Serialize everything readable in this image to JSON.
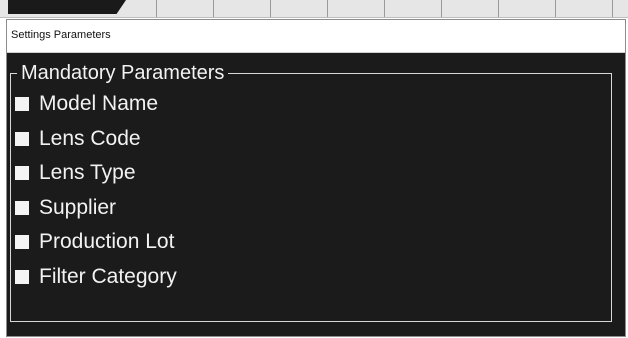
{
  "window": {
    "title": "Settings Parameters"
  },
  "group": {
    "legend": "Mandatory Parameters"
  },
  "parameters": [
    {
      "label": "Model Name",
      "checked": false
    },
    {
      "label": "Lens Code",
      "checked": false
    },
    {
      "label": "Lens Type",
      "checked": false
    },
    {
      "label": "Supplier",
      "checked": false
    },
    {
      "label": "Production Lot",
      "checked": false
    },
    {
      "label": "Filter Category",
      "checked": false
    }
  ],
  "colors": {
    "panel_background": "#1b1b1b",
    "text": "#f2f2f2",
    "checkbox": "#f4f4f4",
    "title_bar": "#ffffff"
  },
  "icons": {
    "checkbox": "square-checkbox-icon"
  }
}
